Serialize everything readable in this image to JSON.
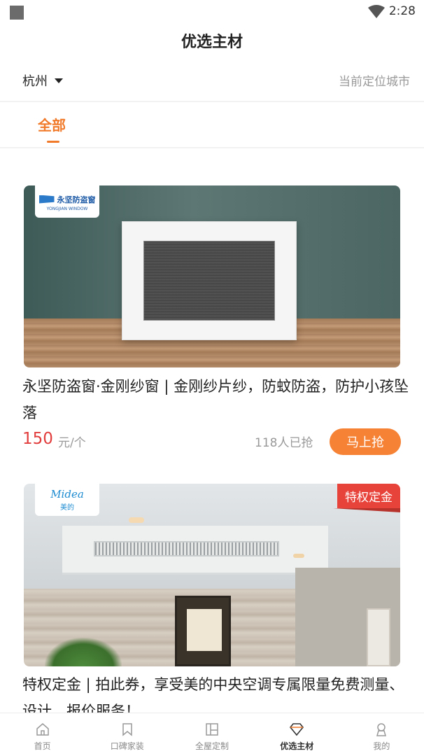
{
  "status_bar": {
    "time": "2:28"
  },
  "header": {
    "title": "优选主材"
  },
  "location": {
    "city": "杭州",
    "locate_link": "当前定位城市"
  },
  "tabs": [
    {
      "label": "全部",
      "active": true
    }
  ],
  "products": [
    {
      "brand_logo_text": "永坚防盗窗",
      "brand_logo_sub": "YONGJIAN WINDOW",
      "title": "永坚防盗窗·金刚纱窗 | 金刚纱片纱，防蚊防盗，防护小孩坠落",
      "price": "150",
      "unit": "元/个",
      "sold": "118人已抢",
      "button": "马上抢"
    },
    {
      "brand_logo_text": "Midea",
      "brand_logo_sub": "美的",
      "badge": "特权定金",
      "title": "特权定金 | 拍此券，享受美的中央空调专属限量免费测量、设计、报价服务！"
    }
  ],
  "tabbar": {
    "items": [
      {
        "label": "首页",
        "icon": "home-icon"
      },
      {
        "label": "口碑家装",
        "icon": "bookmark-icon"
      },
      {
        "label": "全屋定制",
        "icon": "layout-icon"
      },
      {
        "label": "优选主材",
        "icon": "diamond-icon",
        "active": true
      },
      {
        "label": "我的",
        "icon": "user-icon"
      }
    ]
  },
  "colors": {
    "accent": "#f07a2a",
    "price": "#e23d3d",
    "badge": "#e8433a",
    "button": "#f58235"
  }
}
